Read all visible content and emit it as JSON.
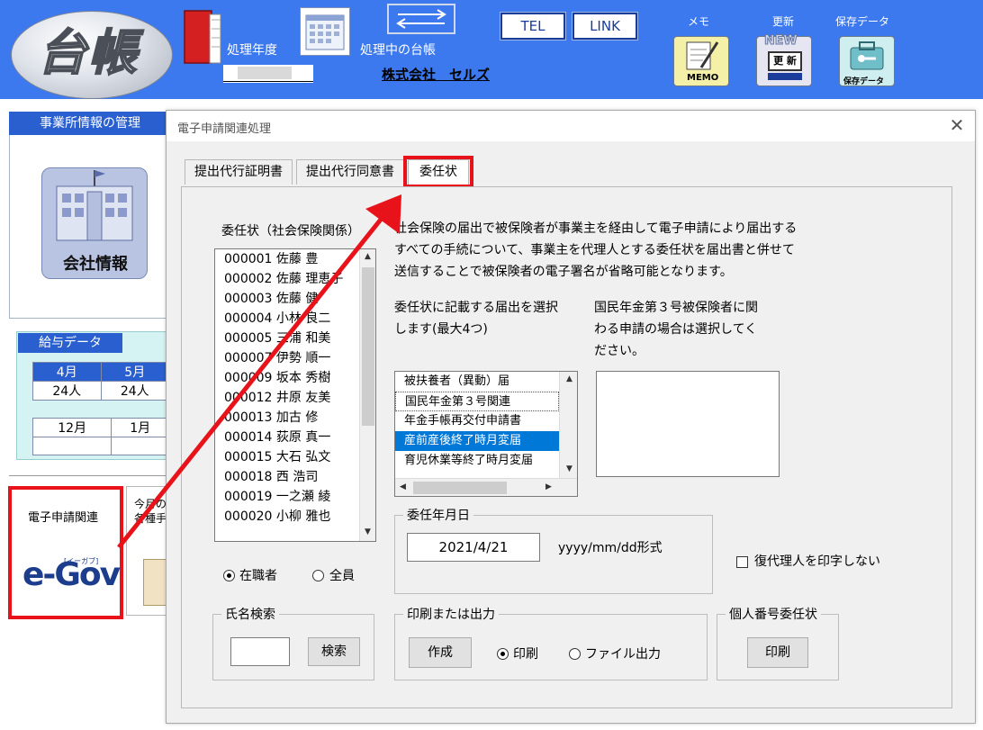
{
  "banner": {
    "logo_text": "台帳",
    "fiscal_year_label": "処理年度",
    "current_ledger_label": "処理中の台帳",
    "company_name": "株式会社　セルズ",
    "tel_label": "TEL",
    "link_label": "LINK",
    "memo_label": "メモ",
    "memo_icon_text": "MEMO",
    "update_label": "更新",
    "update_icon_new": "NEW",
    "update_icon_text": "更 新",
    "save_label": "保存データ",
    "save_icon_text": "保存データ",
    "colors": {
      "banner_bg": "#3c78ee",
      "highlight_red": "#e8131a",
      "selected_blue": "#0078d7"
    }
  },
  "left_panel": {
    "office_tab_label": "事業所情報の管理",
    "company_info_label": "会社情報",
    "payroll_tab_label": "給与データ",
    "payroll_row1_months": [
      "4月",
      "5月"
    ],
    "payroll_row1_counts": [
      "24人",
      "24人"
    ],
    "payroll_row2_months": [
      "12月",
      "1月"
    ],
    "egov_title": "電子申請関連",
    "egov_logo": "e-Gov",
    "egov_logo_sub": "[イーガブ]",
    "monthly_title_1": "今月の",
    "monthly_title_2": "各種手"
  },
  "dialog": {
    "title": "電子申請関連処理",
    "tabs": [
      {
        "label": "提出代行証明書"
      },
      {
        "label": "提出代行同意書"
      },
      {
        "label": "委任状"
      }
    ],
    "employee_list_label": "委任状（社会保険関係）",
    "employees": [
      "000001 佐藤 豊",
      "000002 佐藤 理恵子",
      "000003 佐藤 健",
      "000004 小林 良二",
      "000005 三浦 和美",
      "000007 伊勢 順一",
      "000009 坂本 秀樹",
      "000012 井原 友美",
      "000013 加古 修",
      "000014 荻原 真一",
      "000015 大石 弘文",
      "000018 西 浩司",
      "000019 一之瀬 綾",
      "000020 小柳 雅也"
    ],
    "description_lines": [
      "社会保険の届出で被保険者が事業主を経由して電子申請により届出する",
      "すべての手続について、事業主を代理人とする委任状を届出書と併せて",
      "送信することで被保険者の電子署名が省略可能となります。"
    ],
    "select_label_lines": [
      "委任状に記載する届出を選択",
      "します(最大4つ)"
    ],
    "national_label_lines": [
      "国民年金第３号被保険者に関",
      "わる申請の場合は選択してく",
      "ださい。"
    ],
    "notifications": [
      "被扶養者（異動）届",
      "国民年金第３号関連",
      "年金手帳再交付申請書",
      "産前産後終了時月変届",
      "育児休業等終了時月変届"
    ],
    "selected_notification_index": 3,
    "date_group_label": "委任年月日",
    "date_value": "2021/4/21",
    "date_format_hint": "yyyy/mm/dd形式",
    "no_sub_agent_label": "復代理人を印字しない",
    "radio_employed_label": "在職者",
    "radio_all_label": "全員",
    "name_search_group_label": "氏名検索",
    "search_button_label": "検索",
    "output_group_label": "印刷または出力",
    "create_button_label": "作成",
    "print_radio_label": "印刷",
    "file_radio_label": "ファイル出力",
    "mynumber_group_label": "個人番号委任状",
    "mynumber_print_label": "印刷"
  }
}
